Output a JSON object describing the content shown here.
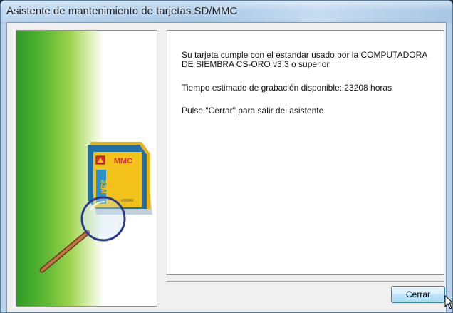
{
  "window": {
    "title": "Asistente de mantenimiento de tarjetas SD/MMC"
  },
  "side_panel": {
    "card_brand": "MMC",
    "card_capacity": "32M",
    "card_maker": "KODAK"
  },
  "content": {
    "message_line1": "Su tarjeta cumple con el estandar usado por la COMPUTADORA DE SIEMBRA CS-ORO v3.3 o superior.",
    "message_line2": "Tiempo estimado de grabación disponible: 23208 horas",
    "message_line3": "Pulse \"Cerrar\" para salir del asistente"
  },
  "buttons": {
    "close_label": "Cerrar"
  },
  "icons": {
    "cursor": "mouse-pointer-icon",
    "illustration": "magnifier-sd-card-illustration"
  },
  "colors": {
    "accent_green": "#3fa62a",
    "card_blue": "#1f6fa8",
    "card_yellow": "#f2c21b",
    "magnifier_ring": "#2b3a8c",
    "magnifier_handle": "#b0633a"
  }
}
